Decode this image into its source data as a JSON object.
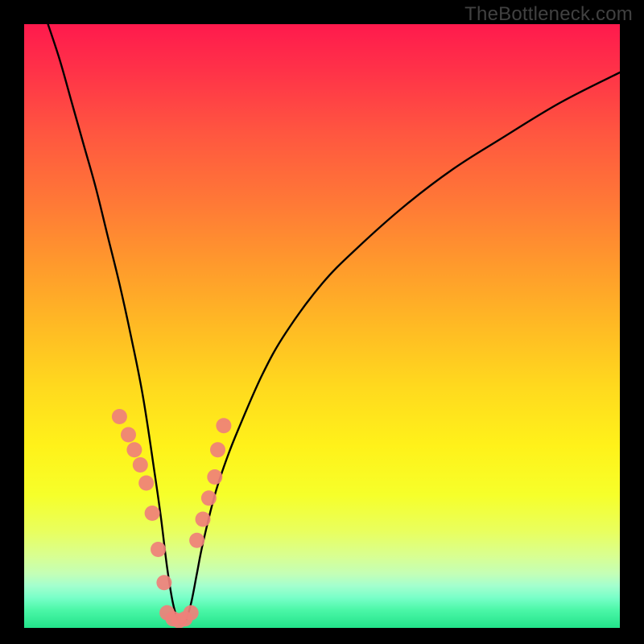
{
  "watermark": "TheBottleneck.com",
  "chart_data": {
    "type": "line",
    "title": "",
    "xlabel": "",
    "ylabel": "",
    "xlim": [
      0,
      100
    ],
    "ylim": [
      0,
      100
    ],
    "background_gradient": {
      "top_color": "#ff1a4d",
      "mid_color": "#fff21a",
      "bottom_color": "#22e38a",
      "meaning": "red=high bottleneck, green=low bottleneck"
    },
    "series": [
      {
        "name": "bottleneck-curve",
        "description": "V-shaped bottleneck percentage curve descending from top-left to a minimum near x≈26 then rising toward top-right",
        "x": [
          4,
          6,
          8,
          10,
          12,
          14,
          16,
          18,
          20,
          22,
          23,
          24,
          25,
          26,
          27,
          28,
          29,
          30,
          32,
          34,
          36,
          40,
          44,
          50,
          56,
          64,
          72,
          80,
          90,
          100
        ],
        "values": [
          100,
          94,
          87,
          80,
          73,
          65,
          57,
          48,
          38,
          25,
          18,
          10,
          4,
          1,
          1,
          4,
          9,
          14,
          22,
          28,
          33,
          42,
          49,
          57,
          63,
          70,
          76,
          81,
          87,
          92
        ]
      },
      {
        "name": "highlight-points-left",
        "description": "Salmon-colored marker cluster on descending (left) arm of curve",
        "x": [
          16.0,
          17.5,
          18.5,
          19.5,
          20.5,
          21.5,
          22.5,
          23.5
        ],
        "values": [
          35.0,
          32.0,
          29.5,
          27.0,
          24.0,
          19.0,
          13.0,
          7.5
        ]
      },
      {
        "name": "highlight-points-bottom",
        "description": "Salmon-colored marker cluster at/near curve minimum",
        "x": [
          24.0,
          25.0,
          26.0,
          27.0,
          28.0
        ],
        "values": [
          2.5,
          1.5,
          1.2,
          1.5,
          2.5
        ]
      },
      {
        "name": "highlight-points-right",
        "description": "Salmon-colored marker cluster on ascending (right) arm of curve",
        "x": [
          29.0,
          30.0,
          31.0,
          32.0,
          32.5,
          33.5
        ],
        "values": [
          14.5,
          18.0,
          21.5,
          25.0,
          29.5,
          33.5
        ]
      }
    ]
  }
}
